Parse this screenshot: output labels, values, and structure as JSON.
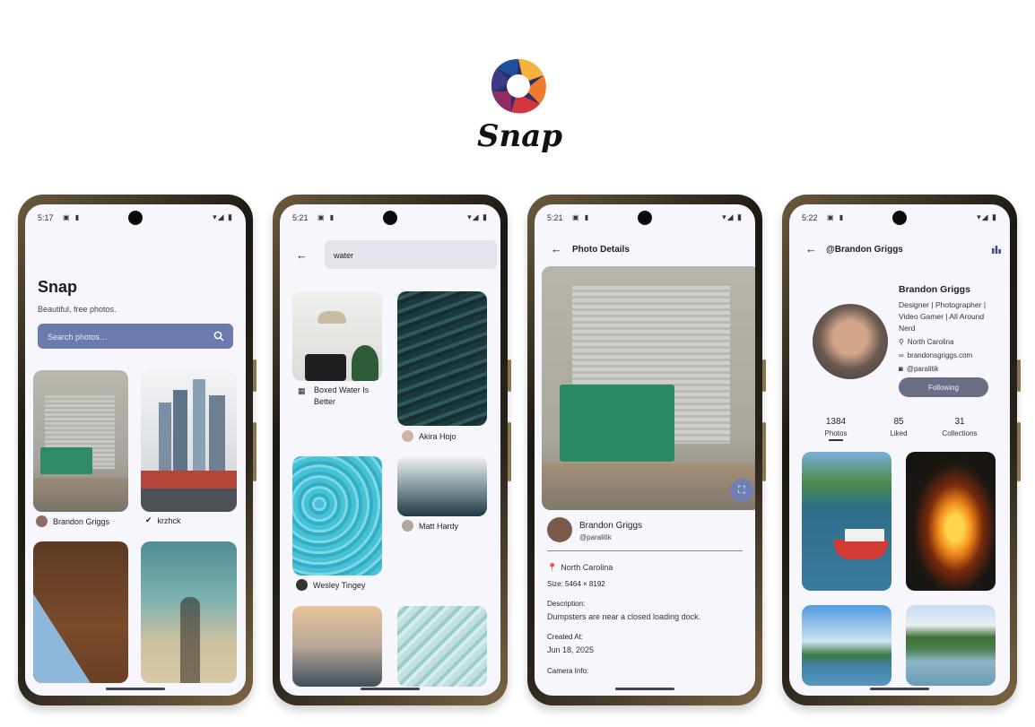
{
  "logo": {
    "wordmark": "Snap"
  },
  "phones": [
    {
      "status": {
        "time": "5:17"
      },
      "title": "Snap",
      "subtitle": "Beautiful, free photos.",
      "search_placeholder": "Search photos…",
      "grid": [
        {
          "author": "Brandon Griggs"
        },
        {
          "author": "krzhck"
        }
      ]
    },
    {
      "status": {
        "time": "5:21"
      },
      "query": "water",
      "grid": [
        {
          "caption": "Boxed Water Is Better"
        },
        {
          "caption": "Akira Hojo"
        },
        {
          "caption": "Wesley Tingey"
        },
        {
          "caption": "Matt Hardy"
        }
      ]
    },
    {
      "status": {
        "time": "5:21"
      },
      "header": "Photo Details",
      "author": {
        "name": "Brandon Griggs",
        "handle": "@paralitik"
      },
      "location": "North Carolina",
      "size": "Size: 5464 × 8192",
      "description_label": "Description:",
      "description": "Dumpsters are near a closed loading dock.",
      "created_label": "Created At:",
      "created": "Jun 18, 2025",
      "camera_label": "Camera Info:"
    },
    {
      "status": {
        "time": "5:22"
      },
      "header": "@Brandon Griggs",
      "name": "Brandon Griggs",
      "bio": "Designer | Photographer | Video Gamer | All Around Nerd",
      "location": "North Carolina",
      "website": "brandonsgriggs.com",
      "instagram": "@paralitik",
      "follow_label": "Following",
      "stats": [
        {
          "value": "1384",
          "label": "Photos"
        },
        {
          "value": "85",
          "label": "Liked"
        },
        {
          "value": "31",
          "label": "Collections"
        }
      ]
    }
  ],
  "colors": {
    "accent": "#6b7bb0",
    "screen_bg": "#f7f6fd",
    "follow_button": "#6b6f85"
  }
}
